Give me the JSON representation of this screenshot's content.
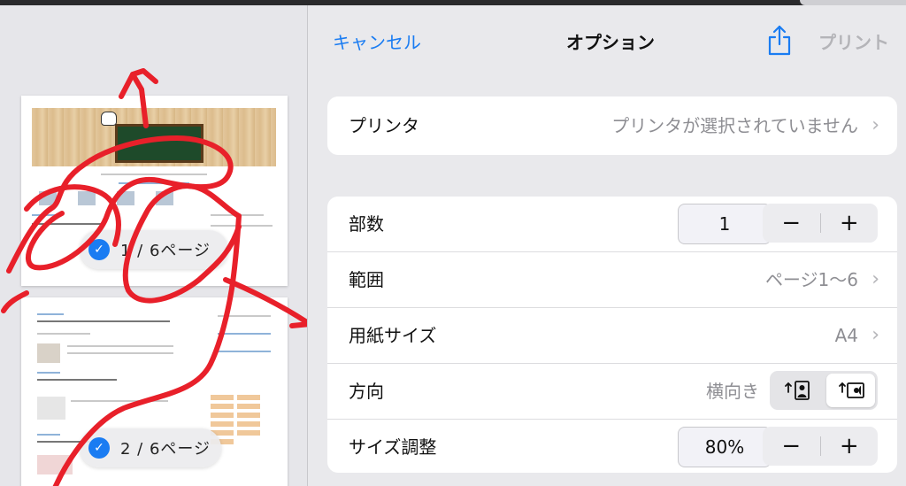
{
  "header": {
    "cancel_label": "キャンセル",
    "title": "オプション",
    "share_icon": "share-icon",
    "print_label": "プリント"
  },
  "printer": {
    "label": "プリンタ",
    "value": "プリンタが選択されていません"
  },
  "options": {
    "copies": {
      "label": "部数",
      "value": "1",
      "minus": "−",
      "plus": "+"
    },
    "range": {
      "label": "範囲",
      "value": "ページ1〜6"
    },
    "paper_size": {
      "label": "用紙サイズ",
      "value": "A4"
    },
    "orientation": {
      "label": "方向",
      "value": "横向き",
      "options": [
        "portrait-icon",
        "landscape-icon"
      ],
      "selected": "landscape-icon"
    },
    "scaling": {
      "label": "サイズ調整",
      "value": "80%",
      "minus": "−",
      "plus": "+"
    }
  },
  "preview": {
    "pages": [
      {
        "label": "1 / 6ページ",
        "checked": true
      },
      {
        "label": "2 / 6ページ",
        "checked": true
      }
    ]
  },
  "colors": {
    "accent": "#1a7cf2",
    "scribble": "#e8202a",
    "disabled": "#b4b4b8"
  }
}
